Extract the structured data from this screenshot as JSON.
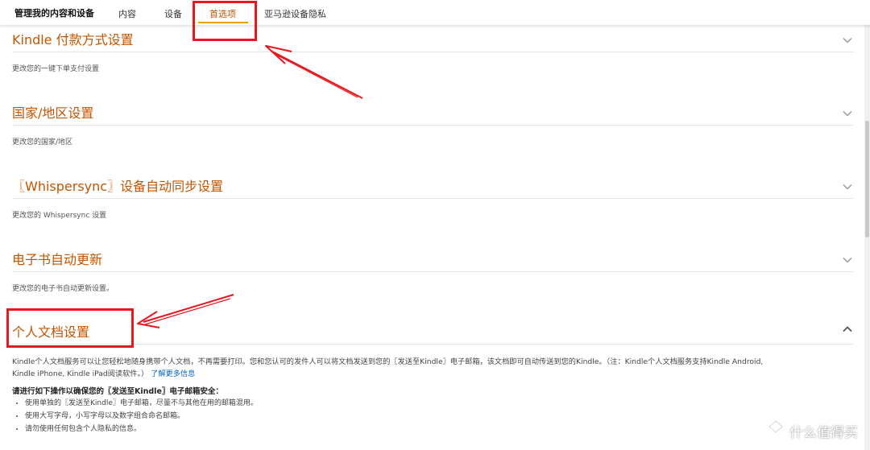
{
  "nav": {
    "title": "管理我的内容和设备",
    "tabs": [
      {
        "label": "内容"
      },
      {
        "label": "设备"
      },
      {
        "label": "首选项"
      },
      {
        "label": "亚马逊设备隐私"
      }
    ]
  },
  "sections": [
    {
      "title": "Kindle 付款方式设置",
      "desc": "更改您的一键下单支付设置"
    },
    {
      "title": "国家/地区设置",
      "desc": "更改您的国家/地区"
    },
    {
      "title": "〖Whispersync〗设备自动同步设置",
      "desc": "更改您的 Whispersync 设置"
    },
    {
      "title": "电子书自动更新",
      "desc": "更改您的电子书自动更新设置。"
    },
    {
      "title": "个人文档设置"
    }
  ],
  "personal_docs": {
    "intro_line1": "Kindle个人文档服务可以让您轻松地随身携带个人文档，不再需要打印。您和您认可的发件人可以将文档发送到您的〖发送至Kindle〗电子邮箱，该文档即可自动传送到您的Kindle。（注：Kindle个人文档服务支持Kindle Android,",
    "intro_line2": "Kindle iPhone, Kindle iPad阅读软件。）",
    "learn_more": "了解更多信息",
    "safety_heading": "请进行如下操作以确保您的〖发送至Kindle〗电子邮箱安全：",
    "rules": [
      "使用单独的〖发送至Kindle〗电子邮箱，尽量不与其他在用的邮箱混用。",
      "使用大写字母，小写字母以及数字组合命名邮箱。",
      "请勿使用任何包含个人隐私的信息。"
    ]
  },
  "watermark": {
    "text": "什么值得买"
  },
  "colors": {
    "accent": "#c45500",
    "highlight": "#e8161d",
    "link": "#0066c0",
    "tab_underline": "#e3a400"
  }
}
